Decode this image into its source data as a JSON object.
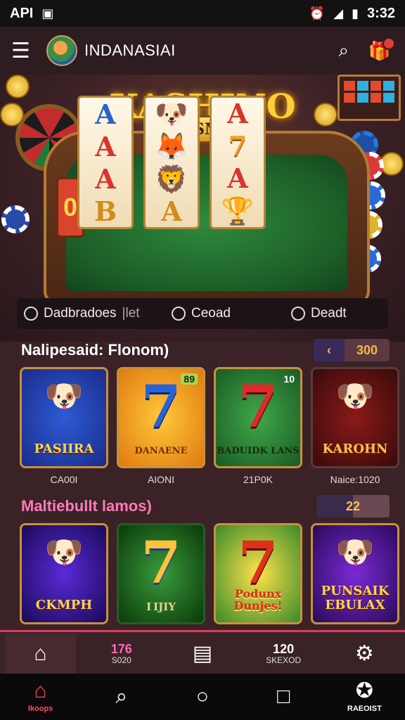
{
  "status_bar": {
    "left_text": "API",
    "time": "3:32"
  },
  "app_bar": {
    "title": "INDANASIAI"
  },
  "hero": {
    "title": "KASHINO",
    "machine_brand": "KASMAZ",
    "reels": [
      [
        "A",
        "A",
        "A",
        "B"
      ],
      [
        "🐶",
        "🦊",
        "🦁",
        "A"
      ],
      [
        "A",
        "7",
        "A",
        "🏆"
      ]
    ],
    "left_window": "0"
  },
  "options": {
    "opt1": "Dadbradoes",
    "opt1_extra": "|let",
    "opt2": "Ceoad",
    "opt3": "Deadt"
  },
  "section1": {
    "title": "Nalipesaid: Flonom)",
    "pager_value": "300",
    "tiles": [
      {
        "label": "PASIIRA",
        "caption": "CA00I",
        "corner": "",
        "face": "🐶"
      },
      {
        "label": "DANAENE",
        "caption": "AIONI",
        "corner": "89",
        "face": ""
      },
      {
        "label": "BADUIDK LANS",
        "caption": "21P0K",
        "corner": "10",
        "face": ""
      },
      {
        "label": "KAROHN",
        "caption": "Naice:1020",
        "corner": "",
        "face": "🐶"
      }
    ]
  },
  "section2": {
    "title": "Maltiebullt lamos)",
    "pager_value": "22",
    "tiles": [
      {
        "label": "CKMPH",
        "face": "🐶"
      },
      {
        "label": "I IJIY",
        "face": ""
      },
      {
        "label": "Podunx Dunjes!",
        "face": ""
      },
      {
        "label": "PUNSAIK EBULAX",
        "face": "🐶"
      }
    ]
  },
  "bottom_nav": {
    "home_icon": "house-icon",
    "item2_value": "176",
    "item2_sub": "S020",
    "item3_icon": "card-icon",
    "item4_value": "120",
    "item4_sub": "SKEXOD",
    "item5_icon": "gear-icon"
  },
  "system_nav": {
    "home_label": "Ikoops",
    "search_icon": "search-icon",
    "circle_icon": "home-circle-icon",
    "square_icon": "recents-icon",
    "right_label": "RAEOIST"
  },
  "colors": {
    "accent": "#e03a5a",
    "gold": "#ffcc3a"
  }
}
